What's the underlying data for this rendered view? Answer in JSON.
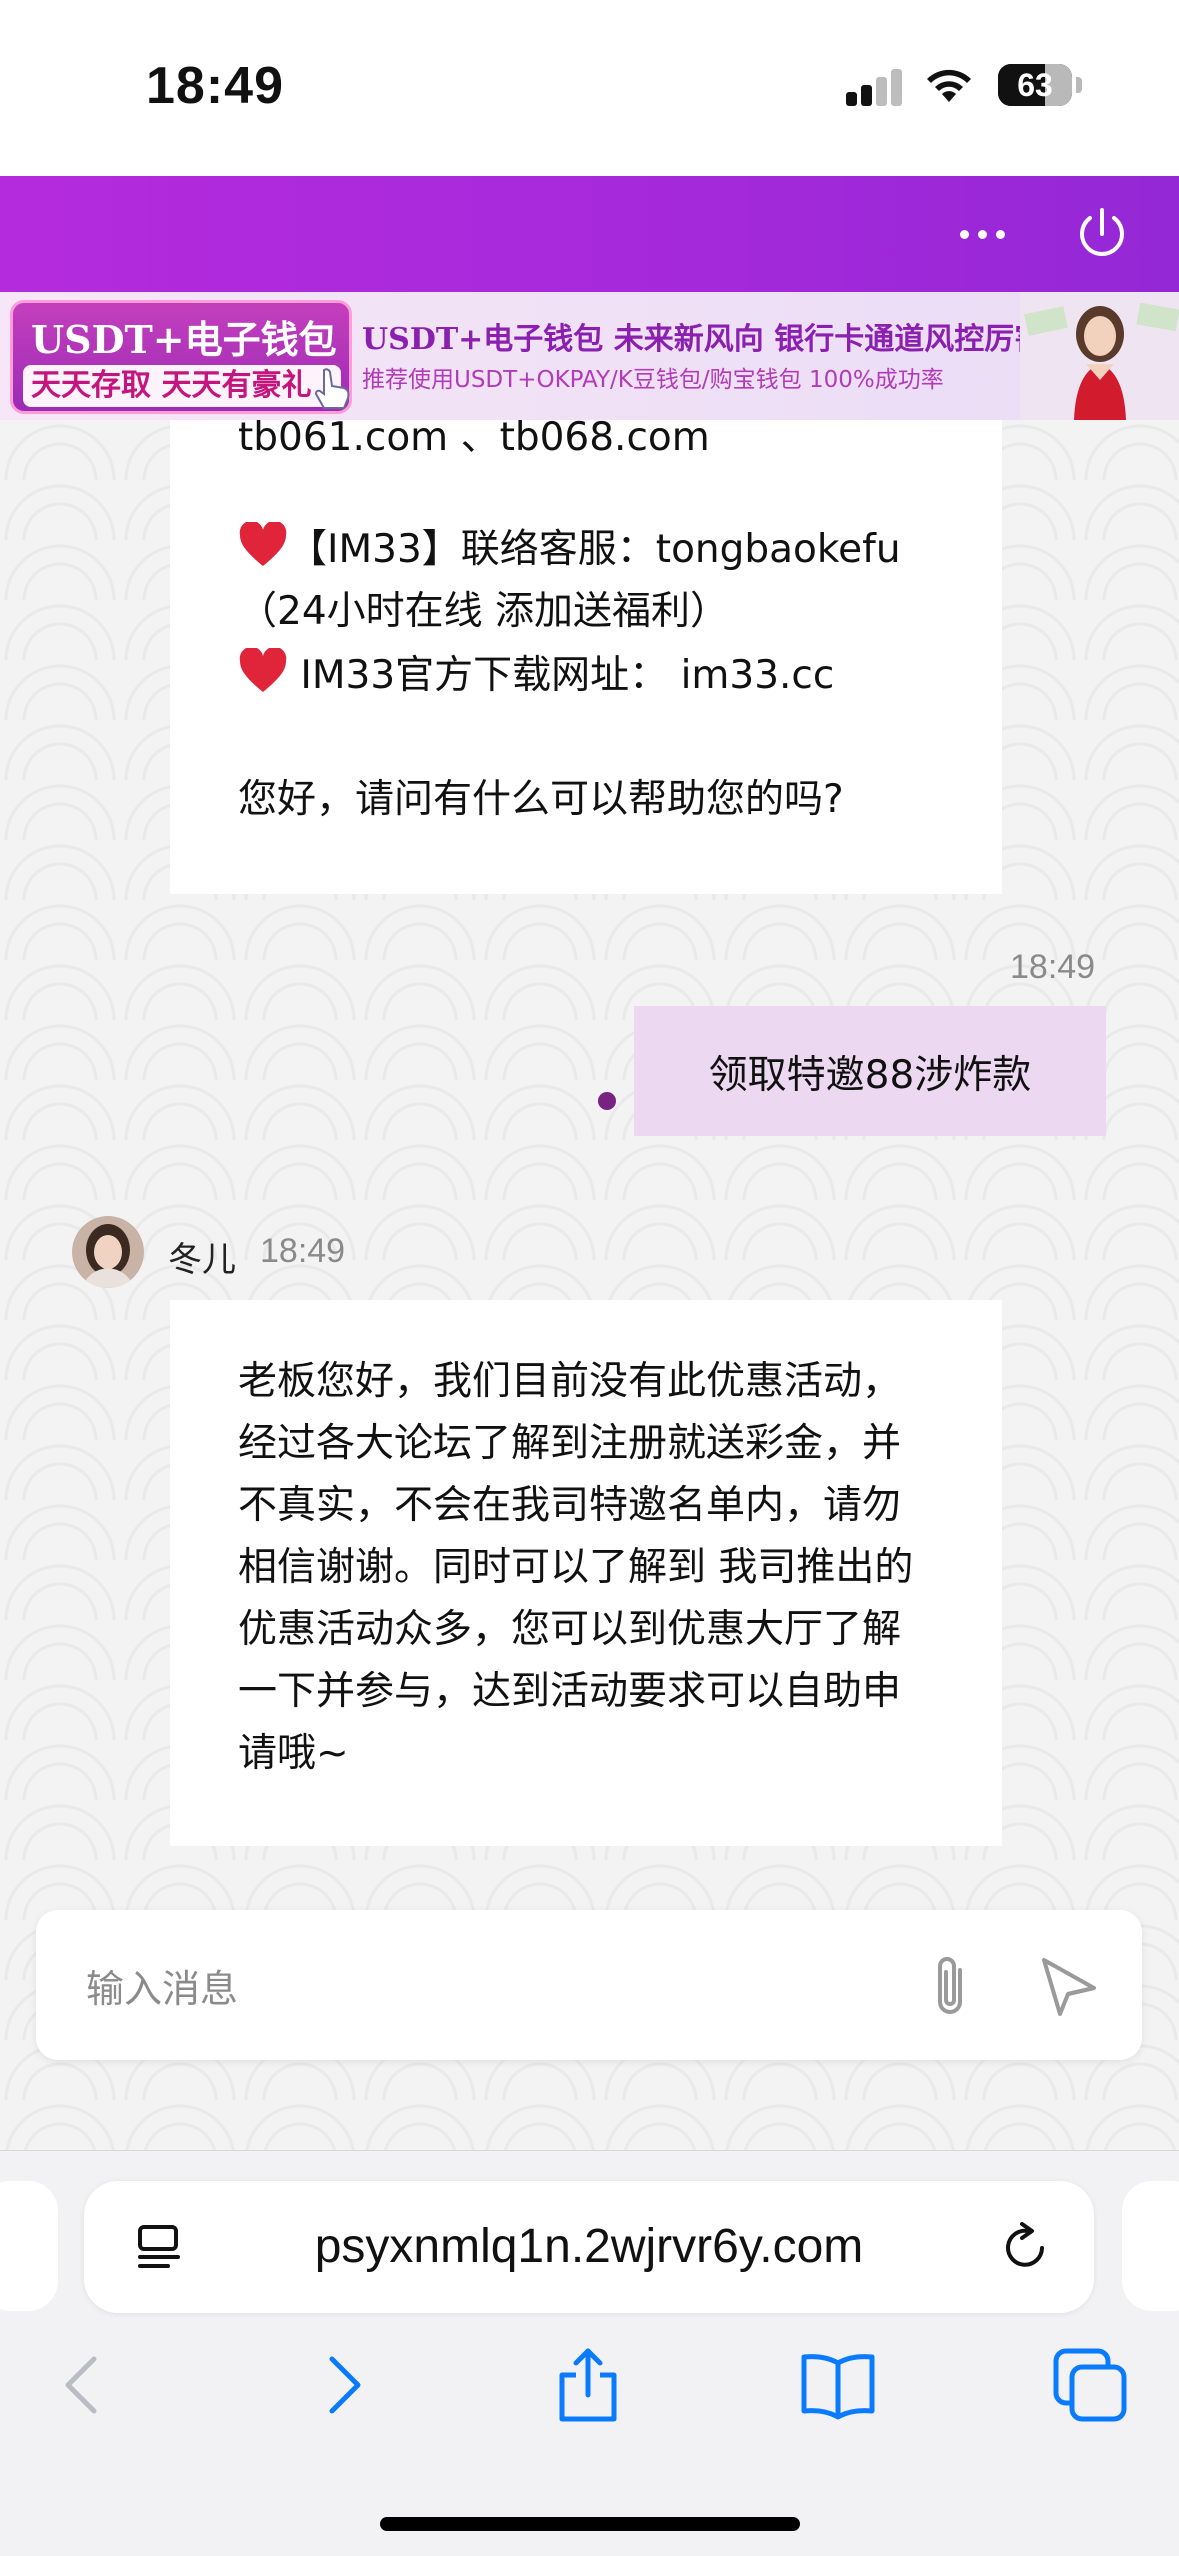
{
  "status_bar": {
    "time": "18:49",
    "battery_level": "63"
  },
  "header": {
    "more_icon": "ellipsis-icon",
    "power_icon": "power-icon"
  },
  "banner": {
    "left_title": "USDT+电子钱包",
    "left_sub": "天天存取 天天有豪礼",
    "line1": "USDT+电子钱包  未来新风向  银行卡通道风控厉害",
    "line2": "推荐使用USDT+OKPAY/K豆钱包/购宝钱包   100%成功率"
  },
  "messages": {
    "first": {
      "line1": "tb061.com 、tb068.com",
      "line2": "【IM33】联络客服：tongbaokefu",
      "line3": "（24小时在线 添加送福利）",
      "line4": " IM33官方下载网址： im33.cc",
      "line5": "您好，请问有什么可以帮助您的吗?"
    },
    "outgoing": {
      "time": "18:49",
      "text": "领取特邀88涉炸款"
    },
    "reply": {
      "sender": "冬儿",
      "time": "18:49",
      "lines": [
        "老板您好，我们目前没有此优惠活动，",
        "经过各大论坛了解到注册就送彩金，并",
        "不真实，不会在我司特邀名单内，请勿",
        "相信谢谢。同时可以了解到 我司推出的",
        "优惠活动众多，您可以到优惠大厅了解",
        "一下并参与，达到活动要求可以自助申",
        "请哦~"
      ]
    }
  },
  "input": {
    "placeholder": "输入消息"
  },
  "browser": {
    "url": "psyxnmlq1n.2wjrvr6y.com"
  },
  "colors": {
    "header": "#a82adc",
    "outgoing_bubble": "#ecd9f1",
    "safari_blue": "#0a7aff"
  }
}
